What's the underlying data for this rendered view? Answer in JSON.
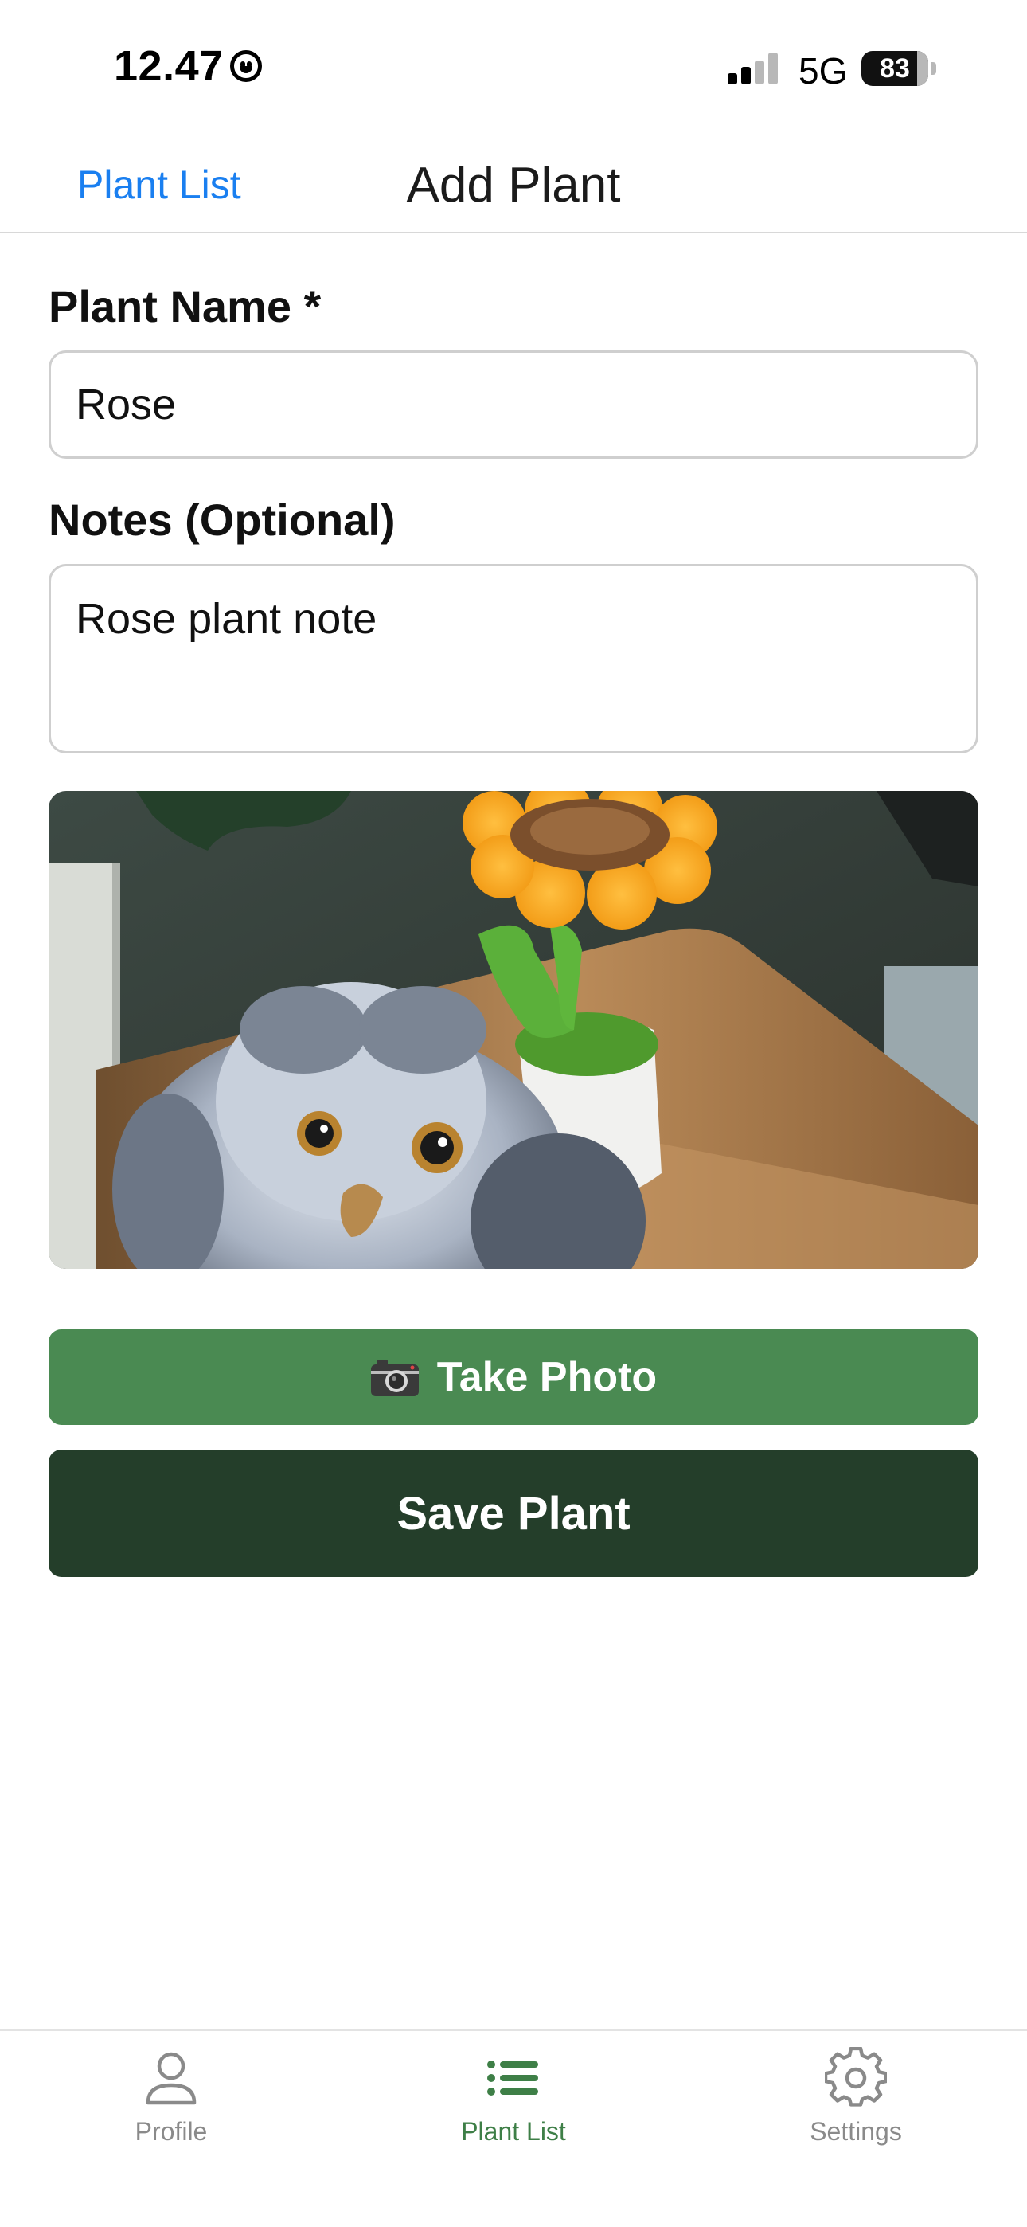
{
  "status_bar": {
    "time": "12.47",
    "network": "5G",
    "battery": "83"
  },
  "nav": {
    "back_label": "Plant List",
    "title": "Add Plant"
  },
  "form": {
    "name_label": "Plant Name *",
    "name_value": "Rose",
    "notes_label": "Notes (Optional)",
    "notes_value": "Rose plant note"
  },
  "photo": {
    "icon": "photo-preview"
  },
  "buttons": {
    "take_photo_label": "Take Photo",
    "take_photo_icon": "camera-icon",
    "take_photo_color": "#4a8a52",
    "save_label": "Save Plant",
    "save_color": "#243e2a"
  },
  "tabbar": {
    "active_color": "#3e7f47",
    "inactive_color": "#8a8a8a",
    "items": [
      {
        "label": "Profile",
        "icon": "person-icon",
        "active": false
      },
      {
        "label": "Plant List",
        "icon": "list-icon",
        "active": true
      },
      {
        "label": "Settings",
        "icon": "gear-icon",
        "active": false
      }
    ]
  }
}
